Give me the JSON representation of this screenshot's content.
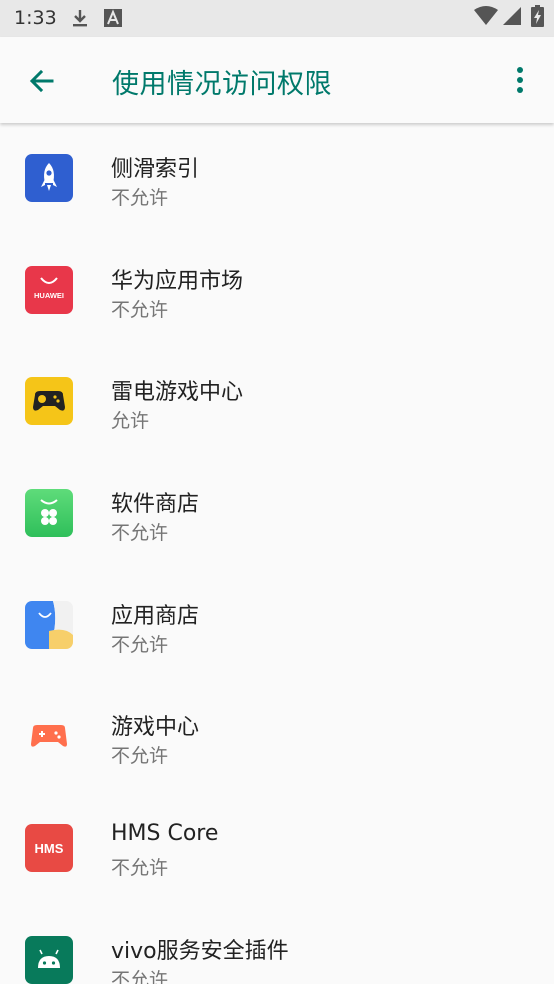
{
  "status_bar": {
    "time": "1:33",
    "icons": [
      "download-icon",
      "font-a-icon",
      "wifi-icon",
      "signal-icon",
      "battery-charging-icon"
    ]
  },
  "app_bar": {
    "title": "使用情况访问权限",
    "back_icon": "arrow-back-icon",
    "menu_icon": "more-vert-icon"
  },
  "colors": {
    "accent": "#00796b",
    "primary_text": "#222222",
    "secondary_text": "#757575",
    "background": "#fafafa"
  },
  "apps": [
    {
      "name": "侧滑索引",
      "status": "不允许",
      "icon": "rocket-app-icon"
    },
    {
      "name": "华为应用市场",
      "status": "不允许",
      "icon": "huawei-appgallery-icon",
      "icon_text": "HUAWEI"
    },
    {
      "name": "雷电游戏中心",
      "status": "允许",
      "icon": "gamepad-app-icon"
    },
    {
      "name": "软件商店",
      "status": "不允许",
      "icon": "software-store-icon"
    },
    {
      "name": "应用商店",
      "status": "不允许",
      "icon": "app-store-icon"
    },
    {
      "name": "游戏中心",
      "status": "不允许",
      "icon": "game-center-icon"
    },
    {
      "name": "HMS Core",
      "status": "不允许",
      "icon": "hms-core-icon",
      "icon_text": "HMS"
    },
    {
      "name": "vivo服务安全插件",
      "status": "不允许",
      "icon": "android-robot-icon"
    }
  ]
}
